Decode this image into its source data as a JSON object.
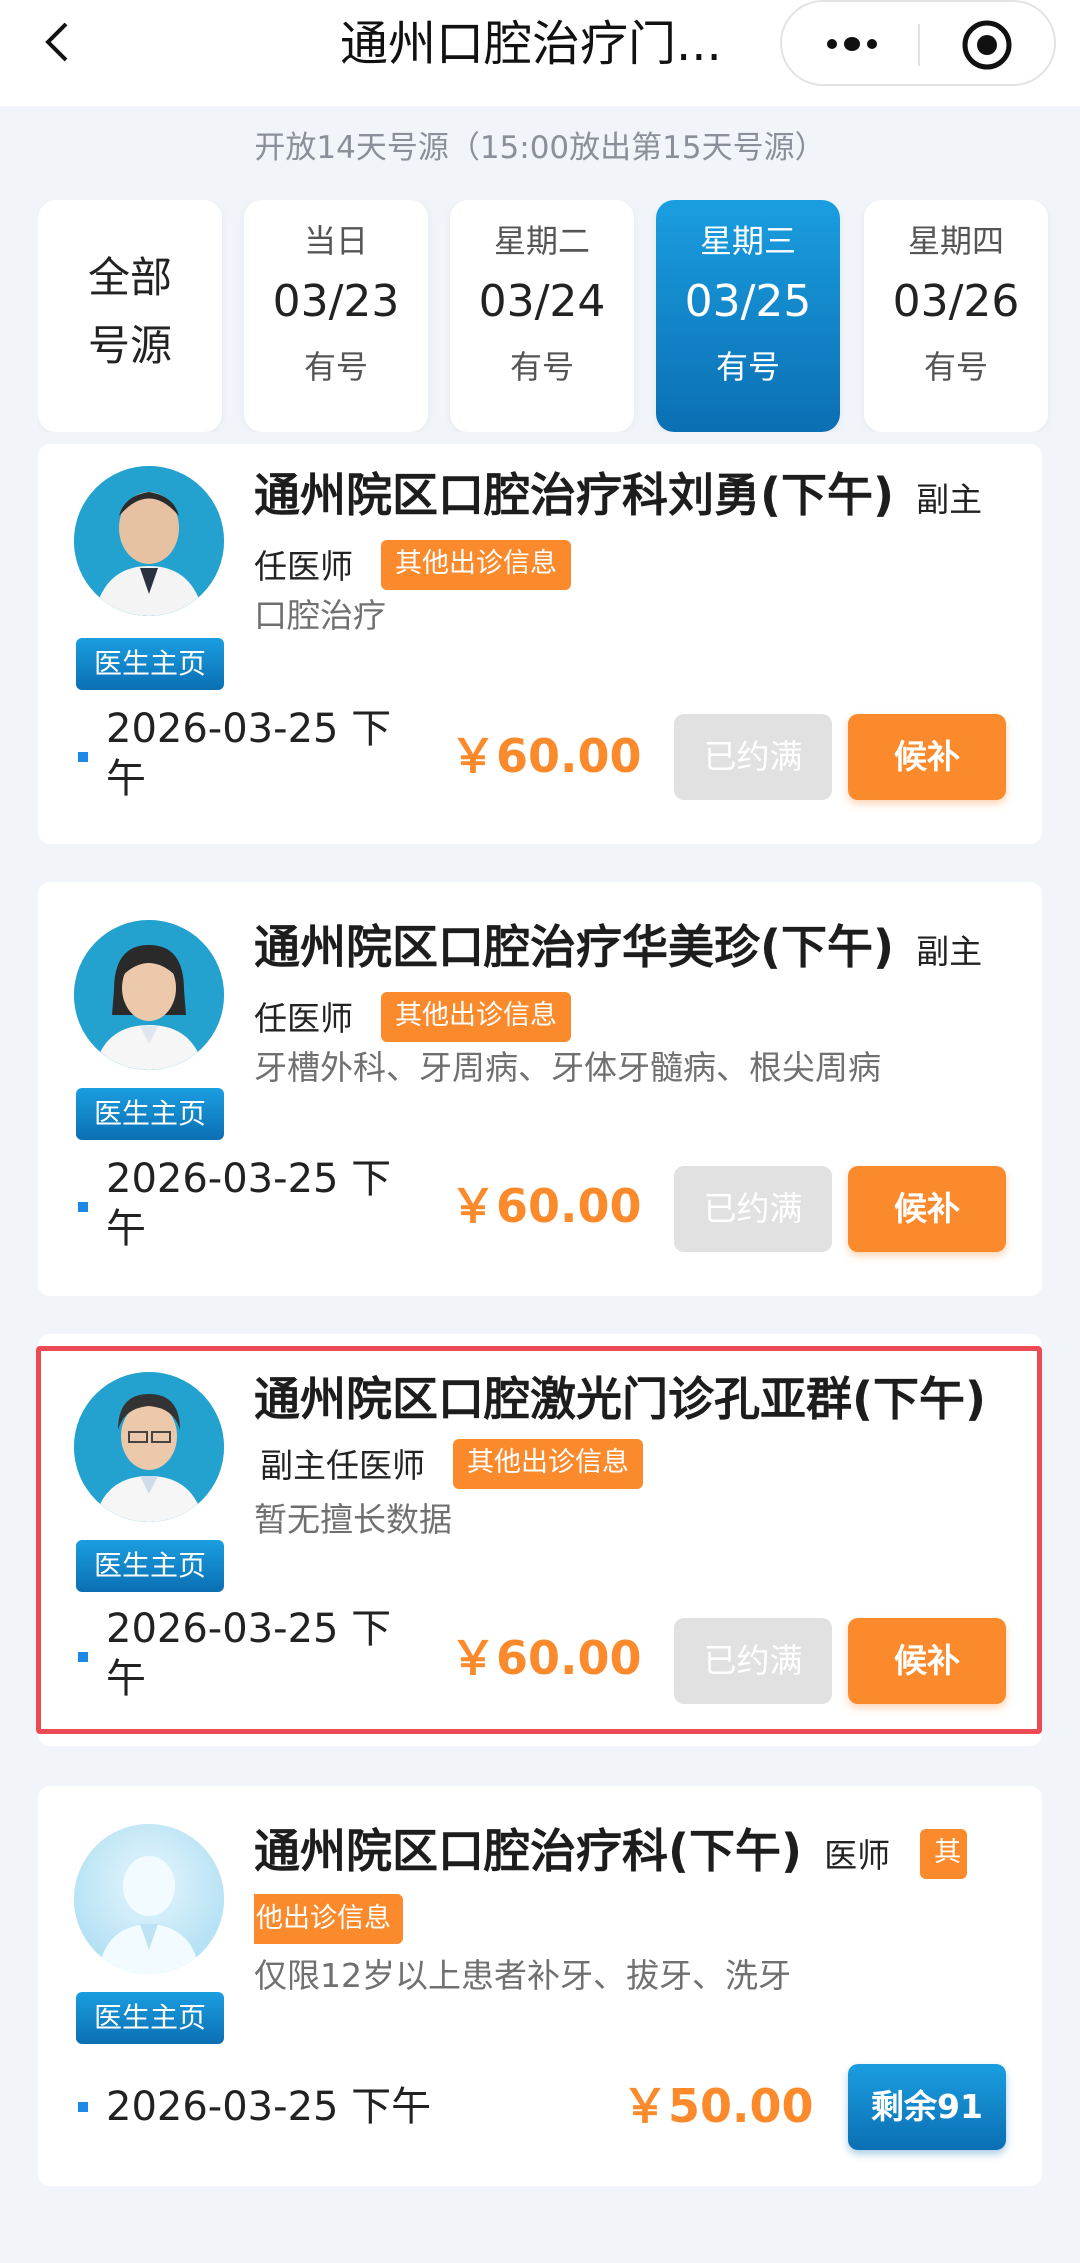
{
  "header": {
    "title": "通州口腔治疗门..."
  },
  "notice": "开放14天号源（15:00放出第15天号源）",
  "date_tabs": {
    "all_label": "全部号源",
    "tabs": [
      {
        "weekday": "当日",
        "date": "03/23",
        "status": "有号"
      },
      {
        "weekday": "星期二",
        "date": "03/24",
        "status": "有号"
      },
      {
        "weekday": "星期三",
        "date": "03/25",
        "status": "有号",
        "selected": true
      },
      {
        "weekday": "星期四",
        "date": "03/26",
        "status": "有号"
      }
    ]
  },
  "common": {
    "home_label": "医生主页",
    "other_info_label": "其他出诊信息",
    "other_info_first": "其",
    "other_info_rest": "他出诊信息",
    "full_label": "已约满",
    "waitlist_label": "候补"
  },
  "doctors": [
    {
      "name": "通州院区口腔治疗科刘勇(下午)",
      "rank": "副主任医师",
      "specialty": "口腔治疗",
      "slot_time": "2026-03-25  下午",
      "price": "￥60.00",
      "status": "已约满"
    },
    {
      "name": "通州院区口腔治疗华美珍(下午)",
      "rank": "副主任医师",
      "specialty": "牙槽外科、牙周病、牙体牙髓病、根尖周病",
      "slot_time": "2026-03-25  下午",
      "price": "￥60.00",
      "status": "已约满"
    },
    {
      "name": "通州院区口腔激光门诊孔亚群(下午)",
      "rank": "副主任医师",
      "specialty": "暂无擅长数据",
      "slot_time": "2026-03-25  下午",
      "price": "￥60.00",
      "status": "已约满"
    },
    {
      "name": "通州院区口腔治疗科(下午)",
      "rank": "医师",
      "specialty": "仅限12岁以上患者补牙、拔牙、洗牙",
      "slot_time": "2026-03-25  下午",
      "price": "￥50.00",
      "remaining": "剩余91"
    }
  ],
  "colors": {
    "accent_blue": "#0b6fb3",
    "accent_orange": "#fb8a2c",
    "highlight_red": "#ec4a55"
  }
}
